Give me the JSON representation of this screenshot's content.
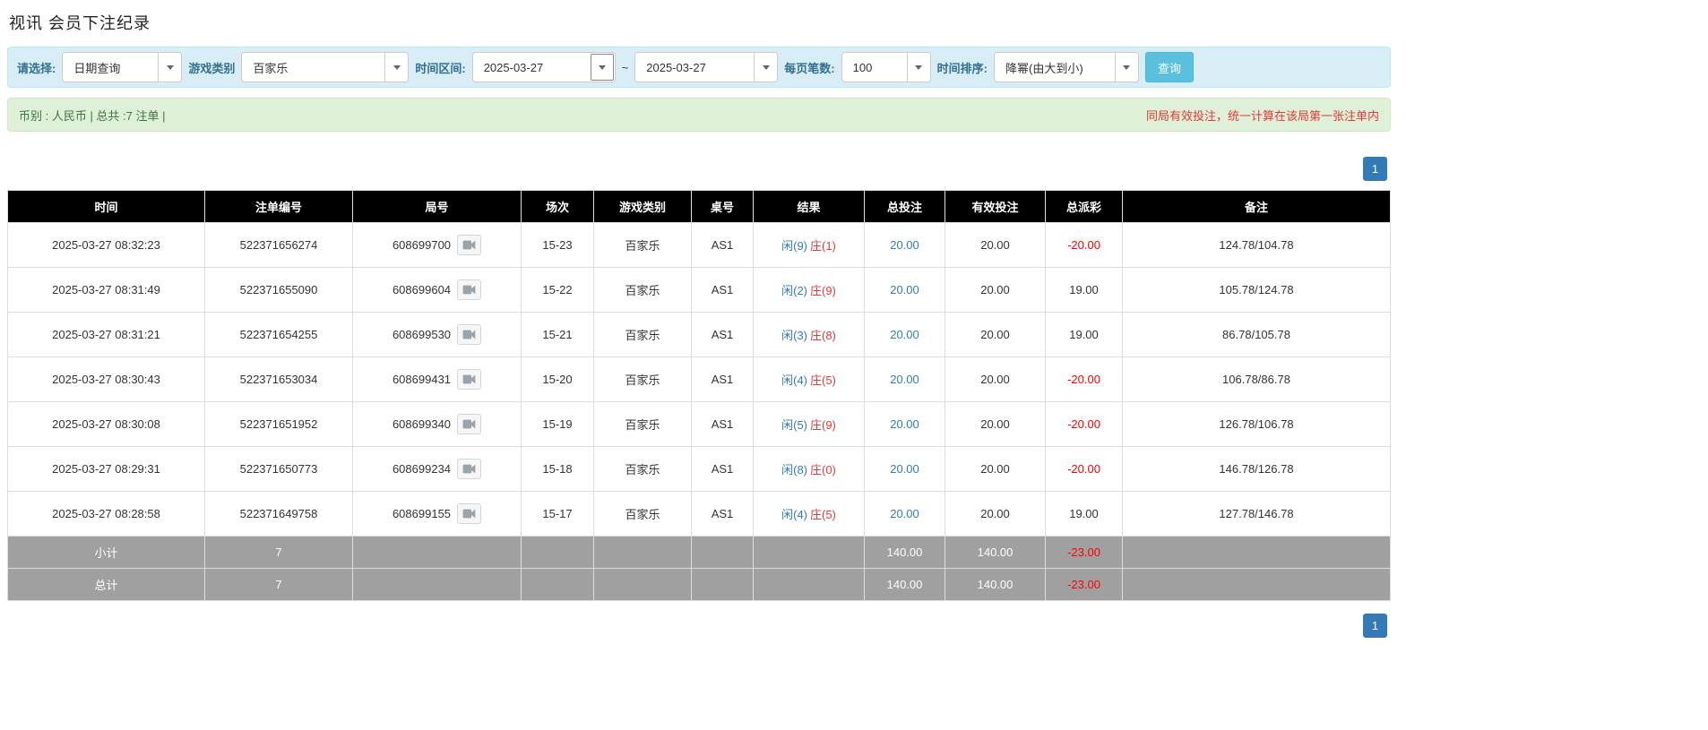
{
  "page": {
    "title": "视讯 会员下注纪录"
  },
  "filter_bar": {
    "select_label": "请选择:",
    "select_value": "日期查询",
    "game_type_label": "游戏类别",
    "game_type_value": "百家乐",
    "time_range_label": "时间区间:",
    "date_from": "2025-03-27",
    "range_separator": "~",
    "date_to": "2025-03-27",
    "page_size_label": "每页笔数:",
    "page_size_value": "100",
    "sort_label": "时间排序:",
    "sort_value": "降幂(由大到小)",
    "query_button_label": "查询"
  },
  "summary_bar": {
    "currency_info": "币别 : 人民币 | 总共 :7 注单 |",
    "notice": "同局有效投注，统一计算在该局第一张注单内"
  },
  "pagination": {
    "current_page": "1"
  },
  "table": {
    "headers": [
      "时间",
      "注单编号",
      "局号",
      "场次",
      "游戏类别",
      "桌号",
      "结果",
      "总投注",
      "有效投注",
      "总派彩",
      "备注"
    ],
    "rows": [
      {
        "time": "2025-03-27 08:32:23",
        "bet_id": "522371656274",
        "round_id": "608699700",
        "session": "15-23",
        "game_type": "百家乐",
        "table_no": "AS1",
        "result_player": "闲(9)",
        "result_banker": "庄(1)",
        "total_bet": "20.00",
        "valid_bet": "20.00",
        "payout": "-20.00",
        "remark": "124.78/104.78"
      },
      {
        "time": "2025-03-27 08:31:49",
        "bet_id": "522371655090",
        "round_id": "608699604",
        "session": "15-22",
        "game_type": "百家乐",
        "table_no": "AS1",
        "result_player": "闲(2)",
        "result_banker": "庄(9)",
        "total_bet": "20.00",
        "valid_bet": "20.00",
        "payout": "19.00",
        "remark": "105.78/124.78"
      },
      {
        "time": "2025-03-27 08:31:21",
        "bet_id": "522371654255",
        "round_id": "608699530",
        "session": "15-21",
        "game_type": "百家乐",
        "table_no": "AS1",
        "result_player": "闲(3)",
        "result_banker": "庄(8)",
        "total_bet": "20.00",
        "valid_bet": "20.00",
        "payout": "19.00",
        "remark": "86.78/105.78"
      },
      {
        "time": "2025-03-27 08:30:43",
        "bet_id": "522371653034",
        "round_id": "608699431",
        "session": "15-20",
        "game_type": "百家乐",
        "table_no": "AS1",
        "result_player": "闲(4)",
        "result_banker": "庄(5)",
        "total_bet": "20.00",
        "valid_bet": "20.00",
        "payout": "-20.00",
        "remark": "106.78/86.78"
      },
      {
        "time": "2025-03-27 08:30:08",
        "bet_id": "522371651952",
        "round_id": "608699340",
        "session": "15-19",
        "game_type": "百家乐",
        "table_no": "AS1",
        "result_player": "闲(5)",
        "result_banker": "庄(9)",
        "total_bet": "20.00",
        "valid_bet": "20.00",
        "payout": "-20.00",
        "remark": "126.78/106.78"
      },
      {
        "time": "2025-03-27 08:29:31",
        "bet_id": "522371650773",
        "round_id": "608699234",
        "session": "15-18",
        "game_type": "百家乐",
        "table_no": "AS1",
        "result_player": "闲(8)",
        "result_banker": "庄(0)",
        "total_bet": "20.00",
        "valid_bet": "20.00",
        "payout": "-20.00",
        "remark": "146.78/126.78"
      },
      {
        "time": "2025-03-27 08:28:58",
        "bet_id": "522371649758",
        "round_id": "608699155",
        "session": "15-17",
        "game_type": "百家乐",
        "table_no": "AS1",
        "result_player": "闲(4)",
        "result_banker": "庄(5)",
        "total_bet": "20.00",
        "valid_bet": "20.00",
        "payout": "19.00",
        "remark": "127.78/146.78"
      }
    ],
    "subtotal": {
      "label": "小计",
      "count": "7",
      "total_bet": "140.00",
      "valid_bet": "140.00",
      "payout": "-23.00"
    },
    "grand_total": {
      "label": "总计",
      "count": "7",
      "total_bet": "140.00",
      "valid_bet": "140.00",
      "payout": "-23.00"
    }
  },
  "colors": {
    "link_blue": "#337ab7",
    "negative_red": "#ff0000",
    "player_blue": "#337ab7",
    "banker_red": "#e4393c",
    "query_button": "#5bc0de",
    "pagination_active": "#337ab7",
    "filter_bar_bg": "#d9edf7",
    "summary_bar_bg": "#dff0d8",
    "header_bg": "#000000",
    "total_row_bg": "#a0a0a0"
  }
}
